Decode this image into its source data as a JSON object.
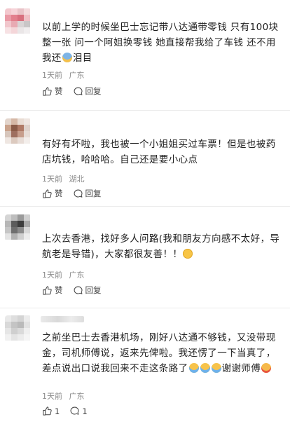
{
  "comments": [
    {
      "text": "以前上学的时候坐巴士忘记带八达通带零钱 只有100块整一张 问一个阿姐换零钱 她直接帮我给了车钱 还不用我还",
      "text_tail": "泪目",
      "emoji_after": "crying-emoji",
      "time": "1天前",
      "location": "广东",
      "like_label": "赞",
      "reply_label": "回复"
    },
    {
      "text": "有好有坏啦，我也被一个小姐姐买过车票！但是也被药店坑钱，哈哈哈。自己还是要小心点",
      "time": "1天前",
      "location": "湖北",
      "like_label": "赞",
      "reply_label": "回复"
    },
    {
      "text": "上次去香港，找好多人问路(我和朋友方向感不太好，导航老是导错)，大家都很友善！！",
      "emoji_after": "smile-emoji",
      "time": "1天前",
      "location": "广东",
      "like_label": "赞",
      "reply_label": "回复"
    },
    {
      "text": "之前坐巴士去香港机场，刚好八达通不够钱，又没带现金，司机师傅说，返来先俾啦。我还愣了一下当真了，差点说出口说我回来不走这条路了",
      "text_tail": "谢谢师傅",
      "emojis": [
        "crying-emoji",
        "crying-emoji",
        "crying-emoji"
      ],
      "emoji_end": "pleading-emoji",
      "time": "1天前",
      "location": "广东",
      "like_count": "1",
      "reply_count": "1"
    }
  ],
  "colors": {
    "text": "#1f1f1f",
    "meta": "#8a8a8a",
    "divider": "#ececec"
  }
}
